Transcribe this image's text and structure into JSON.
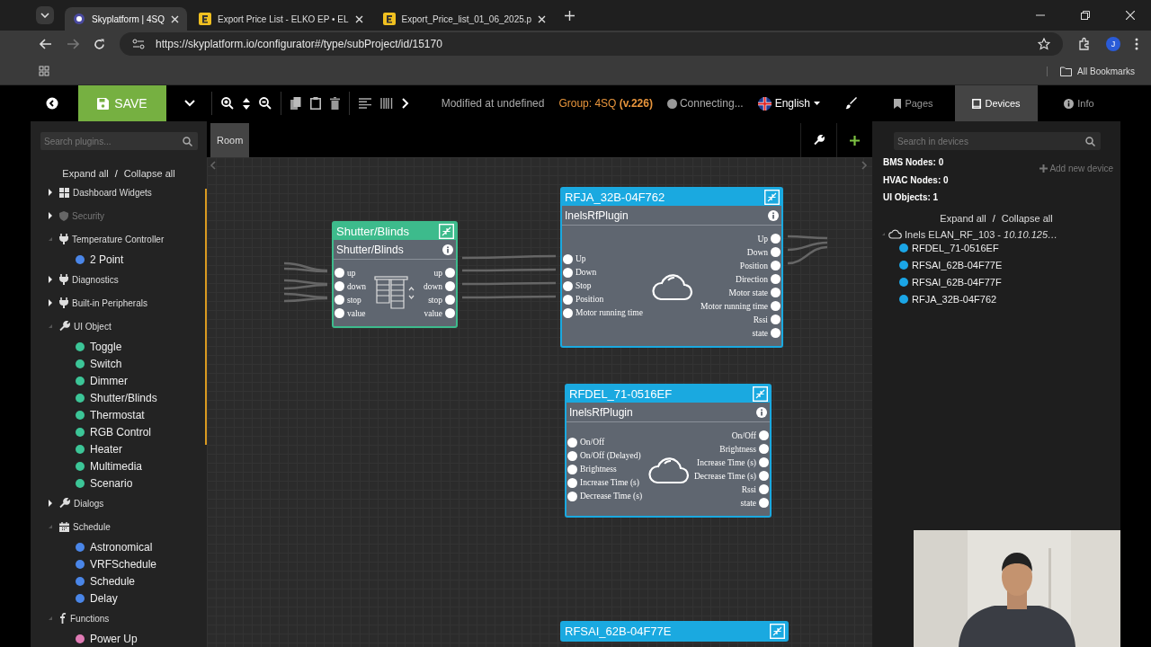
{
  "browser": {
    "tabs": [
      {
        "title": "Skyplatform | 4SQ",
        "kind": "app",
        "selected": true
      },
      {
        "title": "Export Price List - ELKO EP • EL",
        "kind": "doc",
        "selected": false
      },
      {
        "title": "Export_Price_list_01_06_2025.p",
        "kind": "doc",
        "selected": false
      }
    ],
    "url": "https://skyplatform.io/configurator#/type/subProject/id/15170",
    "profile": "J",
    "bookmarks": "All Bookmarks"
  },
  "toolbar": {
    "save": "SAVE",
    "modified": "Modified at undefined",
    "group": "Group: 4SQ",
    "version": "(v.226)",
    "status": "Connecting...",
    "language": "English"
  },
  "right_tabs": [
    {
      "label": "Pages",
      "kind": "bookmark",
      "selected": false
    },
    {
      "label": "Devices",
      "kind": "tablet",
      "selected": true
    },
    {
      "label": "Info",
      "kind": "info",
      "selected": false
    }
  ],
  "left": {
    "search_placeholder": "Search plugins...",
    "expand": "Expand all",
    "separator": "/",
    "collapse": "Collapse all",
    "tree": [
      {
        "label": "Dashboard Widgets",
        "kind": "grid",
        "expanded": false,
        "disabled": false
      },
      {
        "label": "Security",
        "kind": "shield",
        "expanded": false,
        "disabled": true
      },
      {
        "label": "Temperature Controller",
        "kind": "plug",
        "expanded": true,
        "disabled": false,
        "children": [
          {
            "label": "2 Point",
            "color": "#4a86e8"
          }
        ]
      },
      {
        "label": "Diagnostics",
        "kind": "plug",
        "expanded": false,
        "disabled": false
      },
      {
        "label": "Built-in Peripherals",
        "kind": "plug",
        "expanded": false,
        "disabled": false
      },
      {
        "label": "UI Object",
        "kind": "wrench",
        "expanded": true,
        "disabled": false,
        "children": [
          {
            "label": "Toggle",
            "color": "#3cc597"
          },
          {
            "label": "Switch",
            "color": "#3cc597"
          },
          {
            "label": "Dimmer",
            "color": "#3cc597"
          },
          {
            "label": "Shutter/Blinds",
            "color": "#3cc597"
          },
          {
            "label": "Thermostat",
            "color": "#3cc597"
          },
          {
            "label": "RGB Control",
            "color": "#3cc597"
          },
          {
            "label": "Heater",
            "color": "#3cc597"
          },
          {
            "label": "Multimedia",
            "color": "#3cc597"
          },
          {
            "label": "Scenario",
            "color": "#3cc597"
          }
        ]
      },
      {
        "label": "Dialogs",
        "kind": "wrench",
        "expanded": false,
        "disabled": false
      },
      {
        "label": "Schedule",
        "kind": "calendar",
        "expanded": true,
        "disabled": false,
        "children": [
          {
            "label": "Astronomical",
            "color": "#4a86e8"
          },
          {
            "label": "VRFSchedule",
            "color": "#4a86e8"
          },
          {
            "label": "Schedule",
            "color": "#4a86e8"
          },
          {
            "label": "Delay",
            "color": "#4a86e8"
          }
        ]
      },
      {
        "label": "Functions",
        "kind": "function",
        "expanded": true,
        "disabled": false,
        "children": [
          {
            "label": "Power Up",
            "color": "#e07bb5"
          }
        ]
      }
    ]
  },
  "canvas": {
    "tab": "Room",
    "nodes": [
      {
        "kind": "ui",
        "title": "Shutter/Blinds",
        "subtitle": "Shutter/Blinds",
        "inputs": [
          "up",
          "down",
          "stop",
          "value"
        ],
        "outputs": [
          "up",
          "down",
          "stop",
          "value"
        ]
      },
      {
        "kind": "device",
        "title": "RFJA_32B-04F762",
        "subtitle": "InelsRfPlugin",
        "inputs": [
          "Up",
          "Down",
          "Stop",
          "Position",
          "Motor running time"
        ],
        "outputs": [
          "Up",
          "Down",
          "Position",
          "Direction",
          "Motor state",
          "Motor running time",
          "Rssi",
          "state"
        ]
      },
      {
        "kind": "device",
        "title": "RFDEL_71-0516EF",
        "subtitle": "InelsRfPlugin",
        "inputs": [
          "On/Off",
          "On/Off (Delayed)",
          "Brightness",
          "Increase Time (s)",
          "Decrease Time (s)"
        ],
        "outputs": [
          "On/Off",
          "Brightness",
          "Increase Time (s)",
          "Decrease Time (s)",
          "Rssi",
          "state"
        ]
      },
      {
        "kind": "device",
        "title": "RFSAI_62B-04F77E"
      }
    ]
  },
  "right": {
    "search_placeholder": "Search in devices",
    "stats": [
      "BMS Nodes: 0",
      "HVAC Nodes: 0",
      "UI Objects: 1"
    ],
    "add": "Add new device",
    "expand": "Expand all",
    "separator": "/",
    "collapse": "Collapse all",
    "devices": {
      "root": "Inels ELAN_RF_103 - *10.10.125…*",
      "expanded": true,
      "children": [
        {
          "label": "RFDEL_71-0516EF",
          "color": "#1ba6e6"
        },
        {
          "label": "RFSAI_62B-04F77E",
          "color": "#1ba6e6"
        },
        {
          "label": "RFSAI_62B-04F77F",
          "color": "#1ba6e6"
        },
        {
          "label": "RFJA_32B-04F762",
          "color": "#1ba6e6"
        }
      ]
    }
  }
}
